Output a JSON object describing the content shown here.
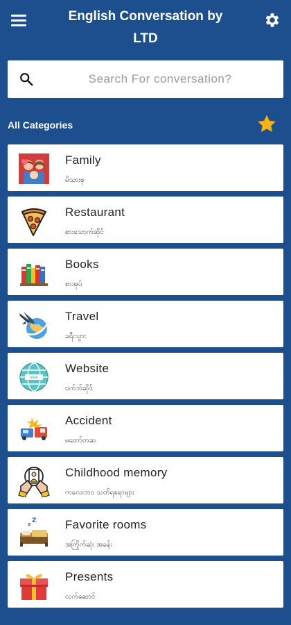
{
  "header": {
    "title": "English Conversation by\nLTD"
  },
  "search": {
    "placeholder": "Search For conversation?"
  },
  "categories_label": "All Categories",
  "items": [
    {
      "title": "Family",
      "subtitle": "မိသားစု",
      "icon": "family-icon"
    },
    {
      "title": "Restaurant",
      "subtitle": "စားသောက်ဆိုင်",
      "icon": "pizza-icon"
    },
    {
      "title": "Books",
      "subtitle": "စာအုပ်",
      "icon": "books-icon"
    },
    {
      "title": "Travel",
      "subtitle": "ခရီးသွား",
      "icon": "airplane-globe-icon"
    },
    {
      "title": "Website",
      "subtitle": "ဝက်ဘ်ဆိုဒ်",
      "icon": "globe-icon"
    },
    {
      "title": "Accident",
      "subtitle": "မတော်တဆ",
      "icon": "crash-icon"
    },
    {
      "title": "Childhood memory",
      "subtitle": "ကလေးဘဝ သတိရစရာများ",
      "icon": "hands-heart-icon"
    },
    {
      "title": "Favorite rooms",
      "subtitle": "အကြိုက်ဆုံး အခန်း",
      "icon": "bed-icon"
    },
    {
      "title": "Presents",
      "subtitle": "လက်ဆောင်",
      "icon": "gift-icon"
    }
  ],
  "colors": {
    "background": "#1d4f8e",
    "card": "#ffffff",
    "star": "#f5b41c"
  }
}
